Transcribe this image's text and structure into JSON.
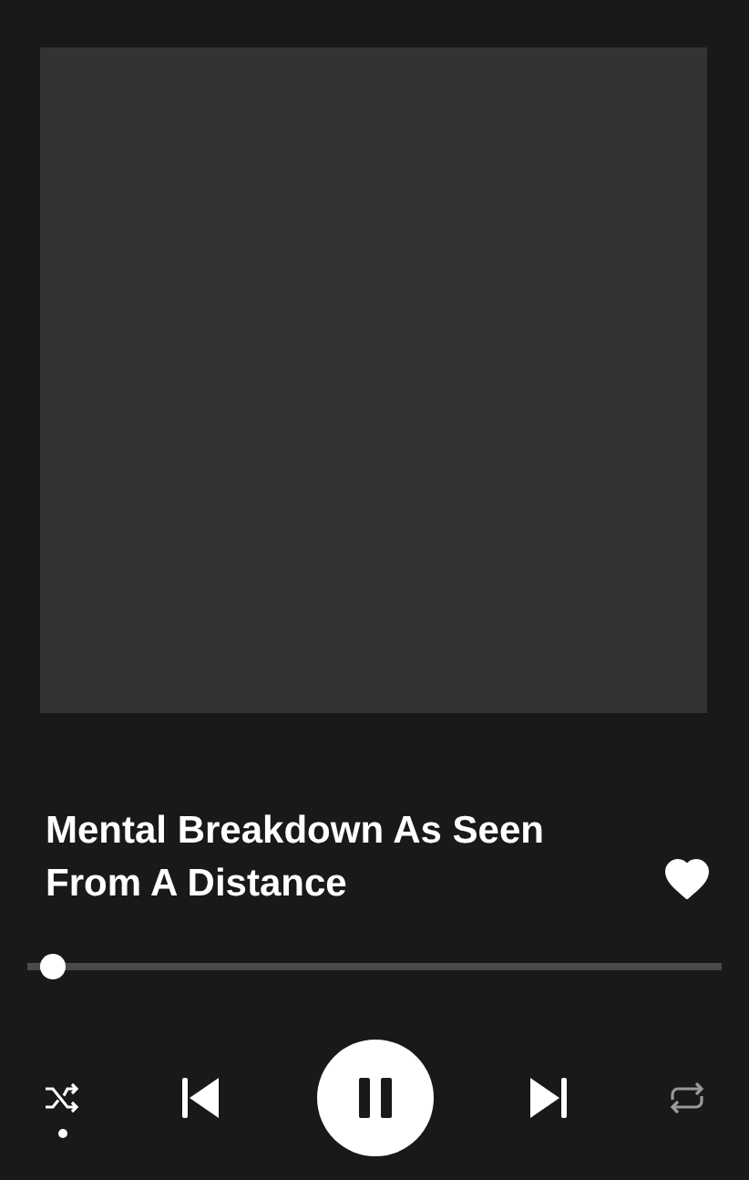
{
  "album_art": {
    "kind": "placeholder"
  },
  "track": {
    "title": "Mental Breakdown As Seen From A Distance",
    "liked": true
  },
  "progress": {
    "level": 0.02
  },
  "controls": {
    "shuffle": {
      "on": true
    },
    "playing": true,
    "repeat": {
      "on": false
    }
  }
}
